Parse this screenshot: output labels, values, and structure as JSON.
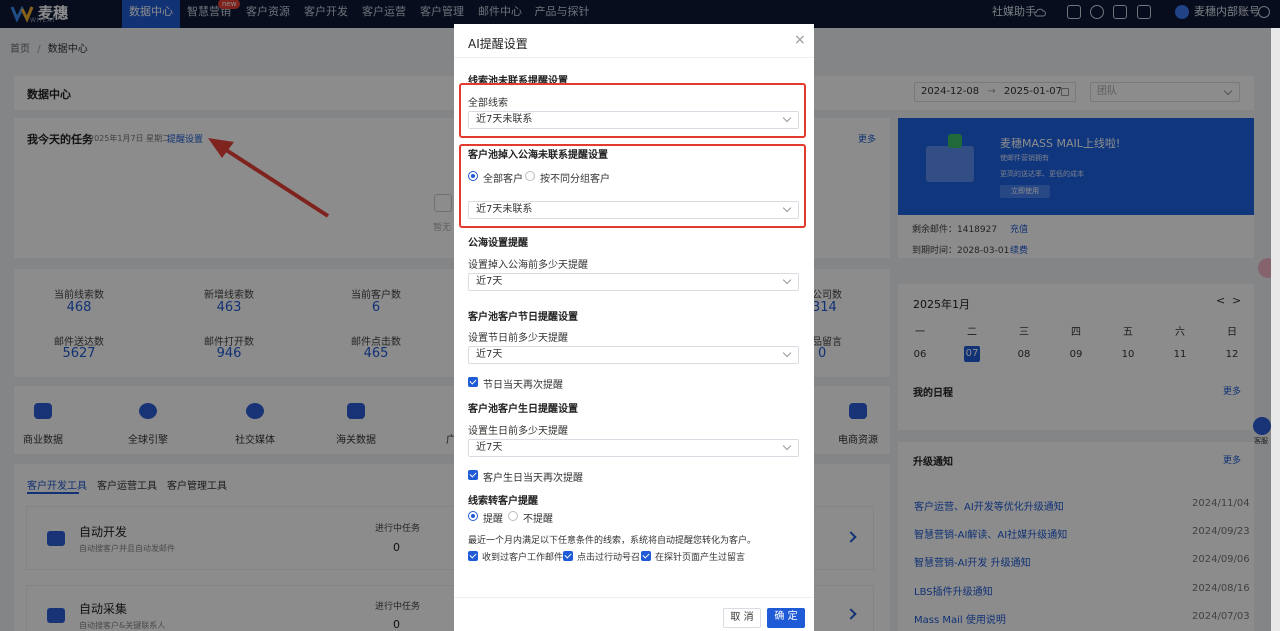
{
  "nav": {
    "brand": "麦穗",
    "brand_sub": "WHEAT",
    "items": [
      "数据中心",
      "智慧营销",
      "客户资源",
      "客户开发",
      "客户运营",
      "客户管理",
      "邮件中心",
      "产品与探针"
    ],
    "new_badge": "new",
    "right_label": "社媒助手",
    "account": "麦穗内部账号"
  },
  "breadcrumb": {
    "home": "首页",
    "sep": "/",
    "current": "数据中心"
  },
  "page": {
    "title": "数据中心",
    "date_start": "2024-12-08",
    "date_arrow": "→",
    "date_end": "2025-01-07",
    "team_placeholder": "团队"
  },
  "tasks": {
    "title": "我今天的任务",
    "date": "2025年1月7日 星期二",
    "setting_link": "提醒设置",
    "more": "更多",
    "empty_text": "暂无"
  },
  "stats": [
    {
      "label": "当前线索数",
      "value": "468"
    },
    {
      "label": "新增线索数",
      "value": "463"
    },
    {
      "label": "当前客户数",
      "value": "6"
    },
    {
      "label": "邮件送达数",
      "value": "5627"
    },
    {
      "label": "邮件打开数",
      "value": "946"
    },
    {
      "label": "邮件点击数",
      "value": "465"
    }
  ],
  "stats_right": [
    {
      "label": "公司数",
      "value": "314"
    },
    {
      "label": "品留言",
      "value": "0"
    }
  ],
  "tools": [
    "商业数据",
    "全球引擎",
    "社交媒体",
    "海关数据",
    "广",
    "电商资源"
  ],
  "tabs": [
    "客户开发工具",
    "客户运营工具",
    "客户管理工具"
  ],
  "dev_tools": [
    {
      "name": "自动开发",
      "desc": "自动搜客户并且自动发邮件",
      "status_label": "进行中任务",
      "count": "0"
    },
    {
      "name": "自动采集",
      "desc": "自动搜客户&关键联系人",
      "status_label": "进行中任务",
      "count": "0"
    }
  ],
  "banner": {
    "title": "麦穗MASS MAIL上线啦!",
    "line1": "使邮件营销拥有",
    "line2": "更高的送达率、更低的成本",
    "button": "立即使用"
  },
  "quota": {
    "mail_label": "剩余邮件：1418927",
    "mail_link": "充值",
    "expire_label": "到期时间：2028-03-01",
    "expire_link": "续费"
  },
  "calendar": {
    "month": "2025年1月",
    "prev": "<",
    "next": ">",
    "weekdays": [
      "一",
      "二",
      "三",
      "四",
      "五",
      "六",
      "日"
    ],
    "days": [
      "06",
      "07",
      "08",
      "09",
      "10",
      "11",
      "12"
    ],
    "today_index": 1,
    "schedule_title": "我的日程",
    "schedule_more": "更多"
  },
  "notices": {
    "title": "升级通知",
    "more": "更多",
    "items": [
      {
        "text": "客户运营、AI开发等优化升级通知",
        "date": "2024/11/04"
      },
      {
        "text": "智慧营销-AI解读、AI社媒升级通知",
        "date": "2024/09/23"
      },
      {
        "text": "智慧营销-AI开发 升级通知",
        "date": "2024/09/06"
      },
      {
        "text": "LBS插件升级通知",
        "date": "2024/08/16"
      },
      {
        "text": "Mass Mail 使用说明",
        "date": "2024/07/03"
      }
    ]
  },
  "service_label": "客服",
  "modal": {
    "title": "AI提醒设置",
    "close": "×",
    "sec1_title": "线索池未联系提醒设置",
    "sec1_label": "全部线索",
    "sec1_select": "近7天未联系",
    "sec2_title": "客户池掉入公海未联系提醒设置",
    "sec2_opt1": "全部客户",
    "sec2_opt2": "按不同分组客户",
    "sec2_select": "近7天未联系",
    "sec3_title": "公海设置提醒",
    "sec3_label": "设置掉入公海前多少天提醒",
    "sec3_select": "近7天",
    "sec4_title": "客户池客户节日提醒设置",
    "sec4_label": "设置节日前多少天提醒",
    "sec4_select": "近7天",
    "sec4_check": "节日当天再次提醒",
    "sec5_title": "客户池客户生日提醒设置",
    "sec5_label": "设置生日前多少天提醒",
    "sec5_select": "近7天",
    "sec5_check": "客户生日当天再次提醒",
    "sec6_title": "线索转客户提醒",
    "sec6_opt1": "提醒",
    "sec6_opt2": "不提醒",
    "sec6_desc": "最近一个月内满足以下任意条件的线索，系统将自动提醒您转化为客户。",
    "sec6_check1": "收到过客户工作邮件",
    "sec6_check2": "点击过行动号召",
    "sec6_check3": "在探针页面产生过留言",
    "cancel": "取 消",
    "confirm": "确 定"
  },
  "colors": {
    "accent": "#1f5bd6",
    "nav_bg": "#0d1836",
    "highlight": "#e43a2e"
  }
}
